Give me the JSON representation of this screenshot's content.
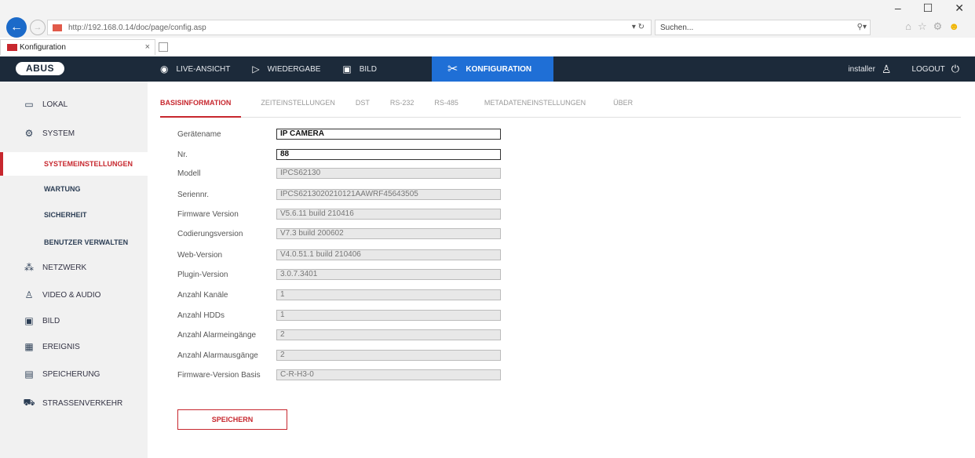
{
  "browser": {
    "address": "http://192.168.0.14/doc/page/config.asp",
    "address_controls": "▾ ↻",
    "search_placeholder": "Suchen...",
    "search_icon": "⚲▾",
    "tab_title": "Konfiguration",
    "tab_close": "×",
    "window_controls": [
      "–",
      "☐",
      "✕"
    ],
    "toolbar_icons": [
      "⌂",
      "☆",
      "⚙",
      "☻"
    ]
  },
  "header": {
    "logo": "ABUS",
    "nav": [
      {
        "icon": "◉",
        "icon_name": "camera-icon",
        "label": "LIVE-ANSICHT"
      },
      {
        "icon": "▷",
        "icon_name": "play-icon",
        "label": "WIEDERGABE"
      },
      {
        "icon": "▣",
        "icon_name": "image-icon",
        "label": "BILD"
      },
      {
        "icon": "✂",
        "icon_name": "config-icon",
        "label": "KONFIGURATION"
      }
    ],
    "user": "installer",
    "user_icon": "♙",
    "logout": "LOGOUT",
    "logout_icon": "⏻"
  },
  "sidebar": {
    "items": [
      {
        "icon": "▭",
        "icon_name": "monitor-icon",
        "label": "LOKAL"
      },
      {
        "icon": "⚙",
        "icon_name": "gear-icon",
        "label": "SYSTEM"
      },
      {
        "icon": "⁂",
        "icon_name": "network-icon",
        "label": "NETZWERK"
      },
      {
        "icon": "♙",
        "icon_name": "microphone-icon",
        "label": "VIDEO & AUDIO"
      },
      {
        "icon": "▣",
        "icon_name": "image-icon",
        "label": "BILD"
      },
      {
        "icon": "▦",
        "icon_name": "calendar-icon",
        "label": "EREIGNIS"
      },
      {
        "icon": "▤",
        "icon_name": "storage-icon",
        "label": "SPEICHERUNG"
      },
      {
        "icon": "⛟",
        "icon_name": "traffic-icon",
        "label": "STRAßENVERKEHR"
      }
    ],
    "subitems": [
      {
        "label": "SYSTEMEINSTELLUNGEN"
      },
      {
        "label": "WARTUNG"
      },
      {
        "label": "SICHERHEIT"
      },
      {
        "label": "BENUTZER VERWALTEN"
      }
    ]
  },
  "tabs": [
    "BASISINFORMATION",
    "ZEITEINSTELLUNGEN",
    "DST",
    "RS-232",
    "RS-485",
    "METADATENEINSTELLUNGEN",
    "ÜBER"
  ],
  "form": [
    {
      "label": "Gerätename",
      "value": "IP CAMERA"
    },
    {
      "label": "Nr.",
      "value": "88"
    },
    {
      "label": "Modell",
      "value": "IPCS62130"
    },
    {
      "label": "Seriennr.",
      "value": "IPCS6213020210121AAWRF45643505"
    },
    {
      "label": "Firmware Version",
      "value": "V5.6.11 build 210416"
    },
    {
      "label": "Codierungsversion",
      "value": "V7.3 build 200602"
    },
    {
      "label": "Web-Version",
      "value": "V4.0.51.1 build 210406"
    },
    {
      "label": "Plugin-Version",
      "value": "3.0.7.3401"
    },
    {
      "label": "Anzahl Kanäle",
      "value": "1"
    },
    {
      "label": "Anzahl HDDs",
      "value": "1"
    },
    {
      "label": "Anzahl Alarmeingänge",
      "value": "2"
    },
    {
      "label": "Anzahl Alarmausgänge",
      "value": "2"
    },
    {
      "label": "Firmware-Version Basis",
      "value": "C-R-H3-0"
    }
  ],
  "save_label": "SPEICHERN"
}
